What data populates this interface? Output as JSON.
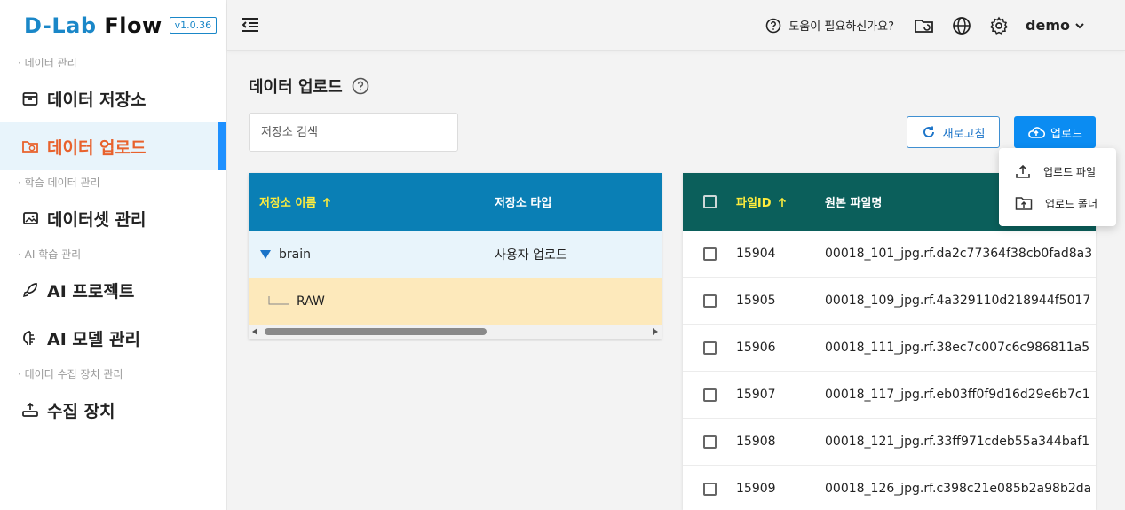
{
  "brand": {
    "logo_prefix": "D-Lab",
    "logo_suffix": "Flow",
    "version": "v1.0.36"
  },
  "sidebar": {
    "sections": [
      {
        "label": "· 데이터 관리"
      },
      {
        "label": "· 학습 데이터 관리"
      },
      {
        "label": "· AI 학습 관리"
      },
      {
        "label": "· 데이터 수집 장치 관리"
      }
    ],
    "items": [
      {
        "label": "데이터 저장소",
        "icon": "archive-icon"
      },
      {
        "label": "데이터 업로드",
        "icon": "folder-sync-icon",
        "active": true
      },
      {
        "label": "데이터셋 관리",
        "icon": "image-stack-icon"
      },
      {
        "label": "AI 프로젝트",
        "icon": "rocket-icon"
      },
      {
        "label": "AI 모델 관리",
        "icon": "brain-icon"
      },
      {
        "label": "수집 장치",
        "icon": "device-upload-icon"
      }
    ]
  },
  "header": {
    "help_text": "도움이 필요하신가요?",
    "user_name": "demo"
  },
  "main": {
    "title": "데이터 업로드",
    "search_placeholder": "저장소 검색",
    "refresh_label": "새로고침",
    "upload_label": "업로드",
    "upload_menu": [
      "업로드 파일",
      "업로드 폴더"
    ]
  },
  "repo_table": {
    "columns": [
      "저장소 이름",
      "저장소 타입"
    ],
    "rows": [
      {
        "name": "brain",
        "type": "사용자 업로드"
      },
      {
        "name": "RAW",
        "type": ""
      }
    ]
  },
  "file_table": {
    "columns": [
      "파일ID",
      "원본 파일명"
    ],
    "rows": [
      {
        "id": "15904",
        "name": "00018_101_jpg.rf.da2c77364f38cb0fad8a3"
      },
      {
        "id": "15905",
        "name": "00018_109_jpg.rf.4a329110d218944f5017"
      },
      {
        "id": "15906",
        "name": "00018_111_jpg.rf.38ec7c007c6c986811a5"
      },
      {
        "id": "15907",
        "name": "00018_117_jpg.rf.eb03ff0f9d16d29e6b7c1"
      },
      {
        "id": "15908",
        "name": "00018_121_jpg.rf.33ff971cdeb55a344baf1"
      },
      {
        "id": "15909",
        "name": "00018_126_jpg.rf.c398c21e085b2a98b2da"
      }
    ]
  }
}
